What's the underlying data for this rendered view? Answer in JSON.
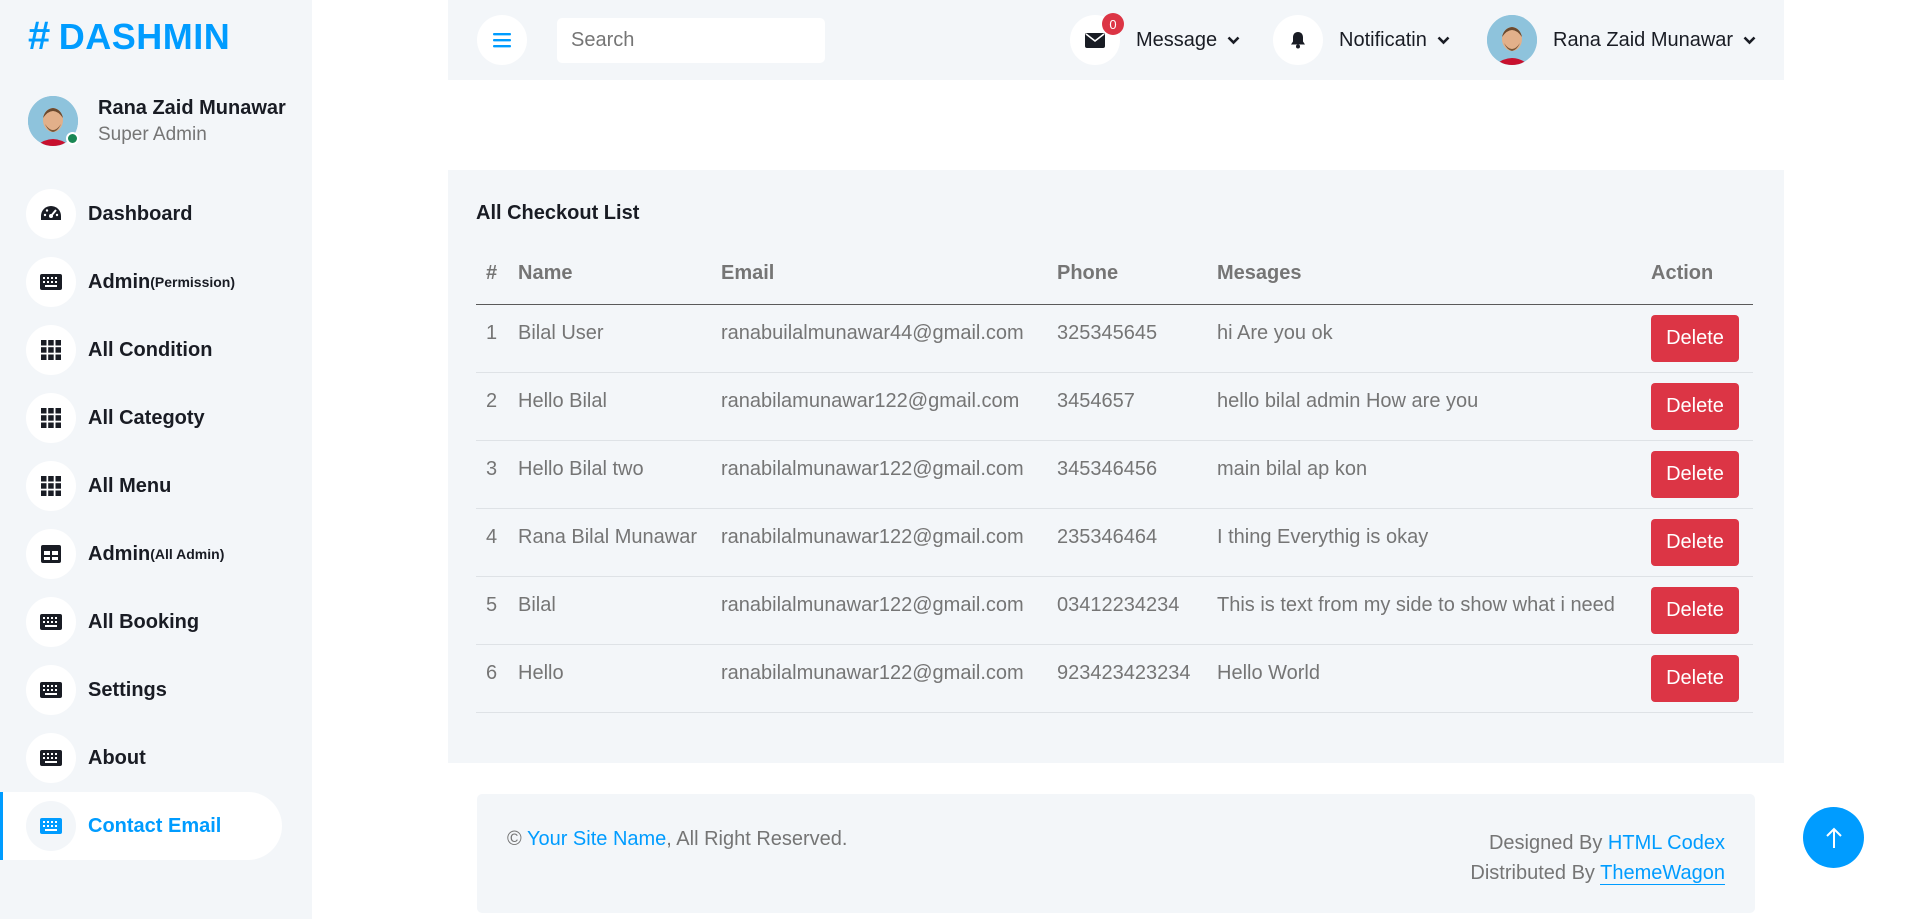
{
  "brand": {
    "hash": "#",
    "name": "DASHMIN"
  },
  "profile": {
    "name": "Rana Zaid Munawar",
    "role": "Super Admin"
  },
  "sidebar": {
    "items": [
      {
        "label": "Dashboard",
        "suffix": "",
        "icon": "speedometer-icon"
      },
      {
        "label": "Admin",
        "suffix": "(Permission)",
        "icon": "keyboard-icon"
      },
      {
        "label": "All Condition",
        "suffix": "",
        "icon": "grid-icon"
      },
      {
        "label": "All Categoty",
        "suffix": "",
        "icon": "grid-icon"
      },
      {
        "label": "All Menu",
        "suffix": "",
        "icon": "grid-icon"
      },
      {
        "label": "Admin ",
        "suffix": "(All Admin)",
        "icon": "table-icon"
      },
      {
        "label": "All Booking",
        "suffix": "",
        "icon": "keyboard-icon"
      },
      {
        "label": "Settings",
        "suffix": "",
        "icon": "keyboard-icon"
      },
      {
        "label": "About",
        "suffix": "",
        "icon": "keyboard-icon"
      },
      {
        "label": "Contact Email",
        "suffix": "",
        "icon": "keyboard-icon",
        "active": true
      }
    ]
  },
  "topbar": {
    "search_placeholder": "Search",
    "message_label": "Message",
    "message_count": "0",
    "notification_label": "Notificatin",
    "user_name": "Rana Zaid Munawar"
  },
  "checkout": {
    "title": "All Checkout List",
    "columns": [
      "#",
      "Name",
      "Email",
      "Phone",
      "Mesages",
      "Action"
    ],
    "rows": [
      {
        "num": "1",
        "name": "Bilal User",
        "email": "ranabuilalmunawar44@gmail.com",
        "phone": "325345645",
        "message": "hi Are you ok",
        "action": "Delete"
      },
      {
        "num": "2",
        "name": "Hello Bilal",
        "email": "ranabilamunawar122@gmail.com",
        "phone": "3454657",
        "message": "hello bilal admin How are you",
        "action": "Delete"
      },
      {
        "num": "3",
        "name": "Hello Bilal two",
        "email": "ranabilalmunawar122@gmail.com",
        "phone": "345346456",
        "message": "main bilal ap kon",
        "action": "Delete"
      },
      {
        "num": "4",
        "name": "Rana Bilal Munawar",
        "email": "ranabilalmunawar122@gmail.com",
        "phone": "235346464",
        "message": "I thing Everythig is okay",
        "action": "Delete"
      },
      {
        "num": "5",
        "name": "Bilal",
        "email": "ranabilalmunawar122@gmail.com",
        "phone": "03412234234",
        "message": "This is text from my side to show what i need",
        "action": "Delete"
      },
      {
        "num": "6",
        "name": "Hello",
        "email": "ranabilalmunawar122@gmail.com",
        "phone": "923423423234",
        "message": "Hello World",
        "action": "Delete"
      }
    ]
  },
  "footer": {
    "copyright": "©",
    "site_name": "Your Site Name",
    "rights": ", All Right Reserved.",
    "designed_by": "Designed By",
    "designer": "HTML Codex",
    "distributed_by": "Distributed By",
    "distributor": "ThemeWagon"
  },
  "colors": {
    "accent": "#009cff",
    "danger": "#dc3545",
    "panel": "#f3f6f9",
    "online": "#198754"
  }
}
